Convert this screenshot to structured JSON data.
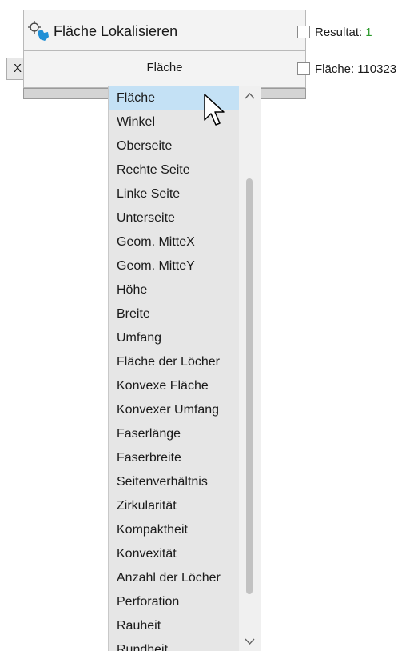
{
  "header": {
    "title": "Fläche Lokalisieren",
    "icon": "locate-shape-icon"
  },
  "toolbar": {
    "close_label": "X",
    "combo_value": "Fläche"
  },
  "result": {
    "label": "Resultat:",
    "value": "1"
  },
  "area": {
    "label": "Fläche:",
    "value": "110323"
  },
  "dropdown": {
    "items": [
      "Fläche",
      "Winkel",
      "Oberseite",
      "Rechte Seite",
      "Linke Seite",
      "Unterseite",
      "Geom. MitteX",
      "Geom. MitteY",
      "Höhe",
      "Breite",
      "Umfang",
      "Fläche der Löcher",
      "Konvexe Fläche",
      "Konvexer Umfang",
      "Faserlänge",
      "Faserbreite",
      "Seitenverhältnis",
      "Zirkularität",
      "Kompaktheit",
      "Konvexität",
      "Anzahl der Löcher",
      "Perforation",
      "Rauheit",
      "Rundheit"
    ],
    "selected_index": 0
  },
  "colors": {
    "selected_background": "#c4e1f5",
    "result_value": "#2e9b2e",
    "icon_accent": "#1f8fd6"
  }
}
